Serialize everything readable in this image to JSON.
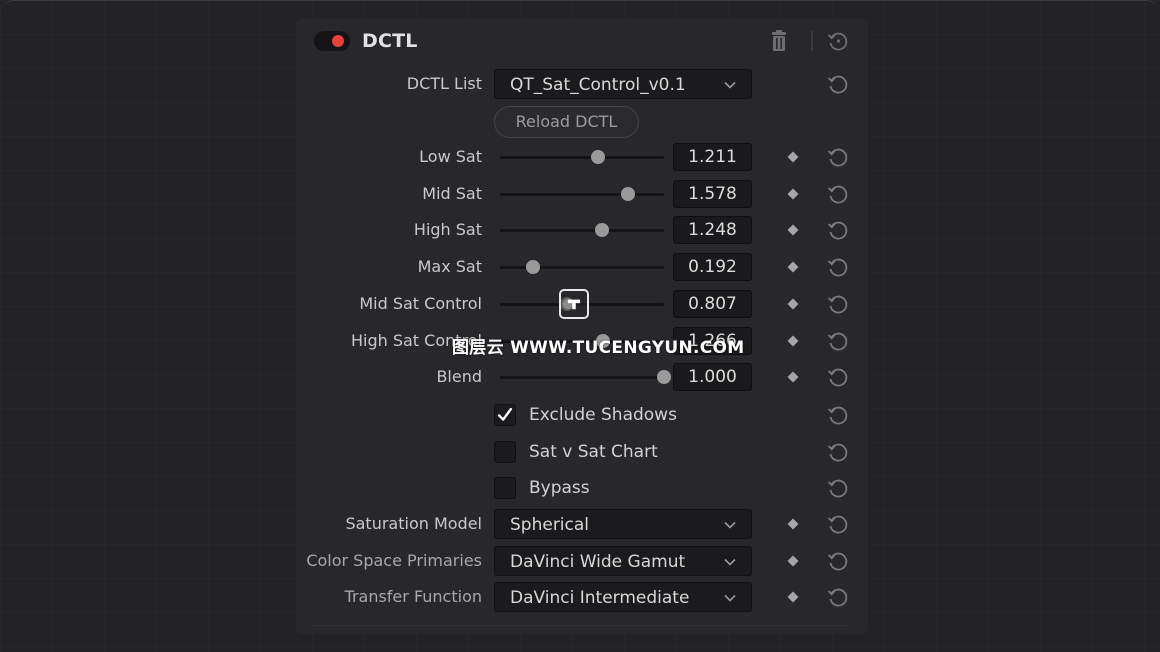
{
  "panel": {
    "title": "DCTL",
    "enabled": true,
    "accent_color": "#e8403a",
    "header_icons": [
      "trash-icon",
      "reset-all-icon"
    ]
  },
  "dctl_list": {
    "label": "DCTL List",
    "value": "QT_Sat_Control_v0.1"
  },
  "reload_button": {
    "label": "Reload DCTL"
  },
  "sliders": [
    {
      "label": "Low Sat",
      "value": "1.211",
      "fraction": 0.6
    },
    {
      "label": "Mid Sat",
      "value": "1.578",
      "fraction": 0.78
    },
    {
      "label": "High Sat",
      "value": "1.248",
      "fraction": 0.62
    },
    {
      "label": "Max Sat",
      "value": "0.192",
      "fraction": 0.2
    },
    {
      "label": "Mid Sat Control",
      "value": "0.807",
      "fraction": 0.41
    },
    {
      "label": "High Sat Control",
      "value": "1.266",
      "fraction": 0.63
    },
    {
      "label": "Blend",
      "value": "1.000",
      "fraction": 1.0
    }
  ],
  "checkboxes": [
    {
      "label": "Exclude Shadows",
      "checked": true,
      "check_glyph": "✓"
    },
    {
      "label": "Sat v Sat Chart",
      "checked": false,
      "check_glyph": ""
    },
    {
      "label": "Bypass",
      "checked": false,
      "check_glyph": ""
    }
  ],
  "dropdowns": [
    {
      "label": "Saturation Model",
      "value": "Spherical"
    },
    {
      "label": "Color Space Primaries",
      "value": "DaVinci Wide Gamut"
    },
    {
      "label": "Transfer Function",
      "value": "DaVinci Intermediate"
    }
  ],
  "watermark": {
    "text": "图层云 WWW.TUCENGYUN.COM"
  }
}
